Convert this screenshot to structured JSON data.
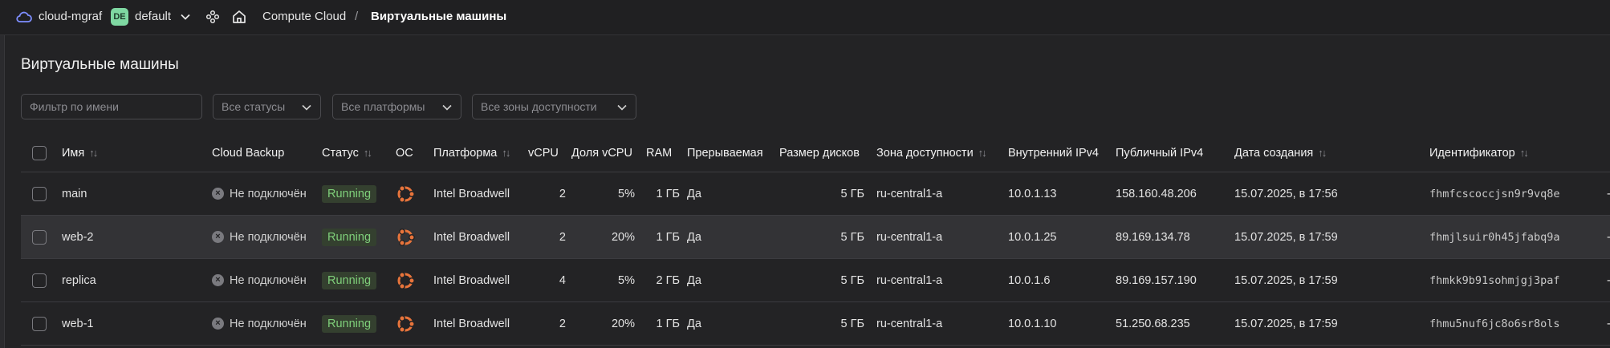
{
  "header": {
    "cloud_name": "cloud-mgraf",
    "folder_badge": "DE",
    "folder_name": "default",
    "breadcrumb_service": "Compute Cloud",
    "breadcrumb_separator": "/",
    "breadcrumb_page": "Виртуальные машины"
  },
  "page": {
    "title": "Виртуальные машины"
  },
  "filters": {
    "name_placeholder": "Фильтр по имени",
    "status_value": "Все статусы",
    "platform_value": "Все платформы",
    "zone_value": "Все зоны доступности"
  },
  "table": {
    "columns": {
      "name": "Имя",
      "backup": "Cloud Backup",
      "status": "Статус",
      "os": "ОС",
      "platform": "Платформа",
      "vcpu": "vCPU",
      "vcpu_share": "Доля vCPU",
      "ram": "RAM",
      "preemptible": "Прерываемая",
      "disk_size": "Размер дисков",
      "zone": "Зона доступности",
      "internal_ip": "Внутренний IPv4",
      "public_ip": "Публичный IPv4",
      "created": "Дата создания",
      "id": "Идентификатор"
    },
    "rows": [
      {
        "name": "main",
        "backup": "Не подключён",
        "status": "Running",
        "os_icon": "ubuntu-icon",
        "platform": "Intel Broadwell",
        "vcpu": "2",
        "vcpu_share": "5%",
        "ram": "1 ГБ",
        "preemptible": "Да",
        "disk_size": "5 ГБ",
        "zone": "ru-central1-a",
        "internal_ip": "10.0.1.13",
        "public_ip": "158.160.48.206",
        "created": "15.07.2025, в 17:56",
        "id": "fhmfcscoccjsn9r9vq8e",
        "extra": "-"
      },
      {
        "name": "web-2",
        "backup": "Не подключён",
        "status": "Running",
        "os_icon": "ubuntu-icon",
        "platform": "Intel Broadwell",
        "vcpu": "2",
        "vcpu_share": "20%",
        "ram": "1 ГБ",
        "preemptible": "Да",
        "disk_size": "5 ГБ",
        "zone": "ru-central1-a",
        "internal_ip": "10.0.1.25",
        "public_ip": "89.169.134.78",
        "created": "15.07.2025, в 17:59",
        "id": "fhmjlsuir0h45jfabq9a",
        "extra": "-"
      },
      {
        "name": "replica",
        "backup": "Не подключён",
        "status": "Running",
        "os_icon": "ubuntu-icon",
        "platform": "Intel Broadwell",
        "vcpu": "4",
        "vcpu_share": "5%",
        "ram": "2 ГБ",
        "preemptible": "Да",
        "disk_size": "5 ГБ",
        "zone": "ru-central1-a",
        "internal_ip": "10.0.1.6",
        "public_ip": "89.169.157.190",
        "created": "15.07.2025, в 17:59",
        "id": "fhmkk9b91sohmjgj3paf",
        "extra": "-"
      },
      {
        "name": "web-1",
        "backup": "Не подключён",
        "status": "Running",
        "os_icon": "ubuntu-icon",
        "platform": "Intel Broadwell",
        "vcpu": "2",
        "vcpu_share": "20%",
        "ram": "1 ГБ",
        "preemptible": "Да",
        "disk_size": "5 ГБ",
        "zone": "ru-central1-a",
        "internal_ip": "10.0.1.10",
        "public_ip": "51.250.68.235",
        "created": "15.07.2025, в 17:59",
        "id": "fhmu5nuf6jc8o6sr8ols",
        "extra": "-"
      }
    ]
  },
  "colors": {
    "background": "#232325",
    "status_running_bg": "#34402f",
    "status_running_text": "#7fcf7a",
    "os_icon": "#e8743b",
    "folder_badge": "#7fd8a2"
  }
}
